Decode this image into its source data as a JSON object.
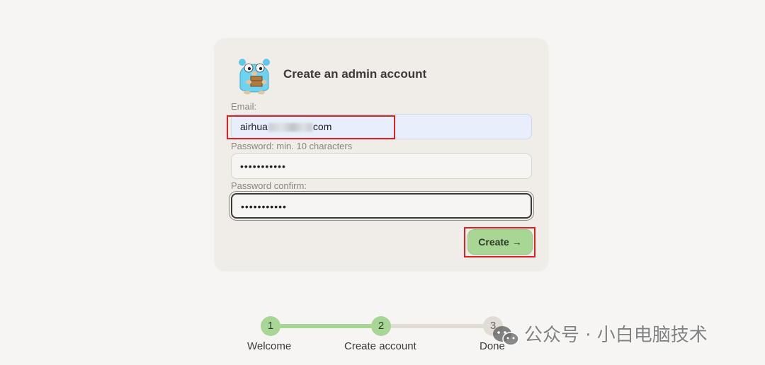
{
  "card": {
    "title": "Create an admin account"
  },
  "form": {
    "email_label": "Email:",
    "email_value_prefix": "airhua",
    "email_value_suffix": "com",
    "password_label": "Password:  min. 10 characters",
    "password_value": "•••••••••••",
    "confirm_label": "Password confirm:",
    "confirm_value": "•••••••••••",
    "create_label": "Create →"
  },
  "steps": [
    {
      "number": "1",
      "label": "Welcome",
      "state": "done"
    },
    {
      "number": "2",
      "label": "Create account",
      "state": "current"
    },
    {
      "number": "3",
      "label": "Done",
      "state": "pending"
    }
  ],
  "watermark": {
    "text": "公众号 · 小白电脑技术",
    "icon": "wechat-icon"
  },
  "colors": {
    "accent_green": "#a8d695",
    "track_done": "#a8d695",
    "track_pending": "#e2dcd6",
    "highlight_red": "#e02020"
  }
}
